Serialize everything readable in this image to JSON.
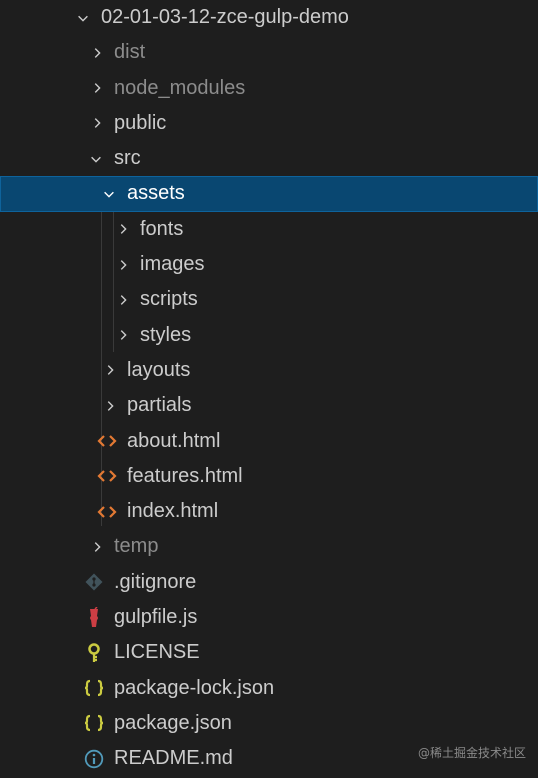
{
  "explorer": {
    "root": {
      "label": "02-01-03-12-zce-gulp-demo",
      "expanded": true
    },
    "items": [
      {
        "label": "dist",
        "kind": "folder",
        "expanded": false,
        "dim": true
      },
      {
        "label": "node_modules",
        "kind": "folder",
        "expanded": false,
        "dim": true
      },
      {
        "label": "public",
        "kind": "folder",
        "expanded": false,
        "dim": false
      },
      {
        "label": "src",
        "kind": "folder",
        "expanded": true,
        "dim": false
      },
      {
        "label": "assets",
        "kind": "folder",
        "expanded": true,
        "selected": true
      },
      {
        "label": "fonts",
        "kind": "folder",
        "expanded": false
      },
      {
        "label": "images",
        "kind": "folder",
        "expanded": false
      },
      {
        "label": "scripts",
        "kind": "folder",
        "expanded": false
      },
      {
        "label": "styles",
        "kind": "folder",
        "expanded": false
      },
      {
        "label": "layouts",
        "kind": "folder",
        "expanded": false
      },
      {
        "label": "partials",
        "kind": "folder",
        "expanded": false
      },
      {
        "label": "about.html",
        "kind": "file",
        "icon": "html-icon"
      },
      {
        "label": "features.html",
        "kind": "file",
        "icon": "html-icon"
      },
      {
        "label": "index.html",
        "kind": "file",
        "icon": "html-icon"
      },
      {
        "label": "temp",
        "kind": "folder",
        "expanded": false,
        "dim": true
      },
      {
        "label": ".gitignore",
        "kind": "file",
        "icon": "git-icon"
      },
      {
        "label": "gulpfile.js",
        "kind": "file",
        "icon": "gulp-icon"
      },
      {
        "label": "LICENSE",
        "kind": "file",
        "icon": "license-icon"
      },
      {
        "label": "package-lock.json",
        "kind": "file",
        "icon": "json-icon"
      },
      {
        "label": "package.json",
        "kind": "file",
        "icon": "json-icon"
      },
      {
        "label": "README.md",
        "kind": "file",
        "icon": "info-icon"
      }
    ]
  },
  "colors": {
    "background": "#1e1e1e",
    "selection": "#094771",
    "text": "#cccccc",
    "dim_text": "#8c8c8c",
    "html_icon": "#e37933",
    "json_icon": "#cbcb41",
    "info_icon": "#519aba",
    "gulp_icon": "#cc3e44",
    "git_icon": "#41535b"
  },
  "watermark": "@稀土掘金技术社区"
}
